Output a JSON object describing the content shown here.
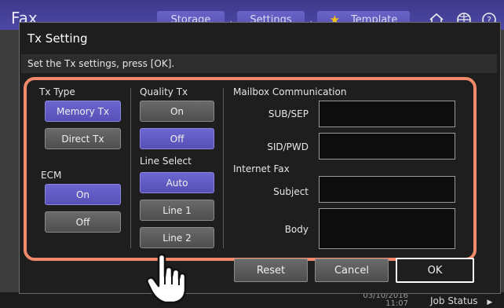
{
  "app": {
    "title": "Fax"
  },
  "topbar": {
    "storage": "Storage",
    "settings": "Settings",
    "template": "Template"
  },
  "status": {
    "date": "03/10/2016",
    "time": "11:07",
    "job_status": "Job Status"
  },
  "dialog": {
    "title": "Tx Setting",
    "instruction": "Set the Tx settings, press [OK].",
    "tx_type": {
      "label": "Tx Type",
      "memory": "Memory Tx",
      "direct": "Direct Tx",
      "selected": "Memory Tx"
    },
    "ecm": {
      "label": "ECM",
      "on": "On",
      "off": "Off",
      "selected": "On"
    },
    "quality_tx": {
      "label": "Quality Tx",
      "on": "On",
      "off": "Off",
      "selected": "Off"
    },
    "line_select": {
      "label": "Line Select",
      "auto": "Auto",
      "line1": "Line 1",
      "line2": "Line 2",
      "selected": "Auto"
    },
    "mailbox": {
      "label": "Mailbox Communication",
      "sub_sep": "SUB/SEP",
      "sid_pwd": "SID/PWD"
    },
    "internet_fax": {
      "label": "Internet Fax",
      "subject": "Subject",
      "body": "Body"
    },
    "buttons": {
      "reset": "Reset",
      "cancel": "Cancel",
      "ok": "OK"
    }
  },
  "colors": {
    "accent": "#5650b6",
    "highlight": "#f08a6a",
    "topbar": "#4c47a6"
  }
}
